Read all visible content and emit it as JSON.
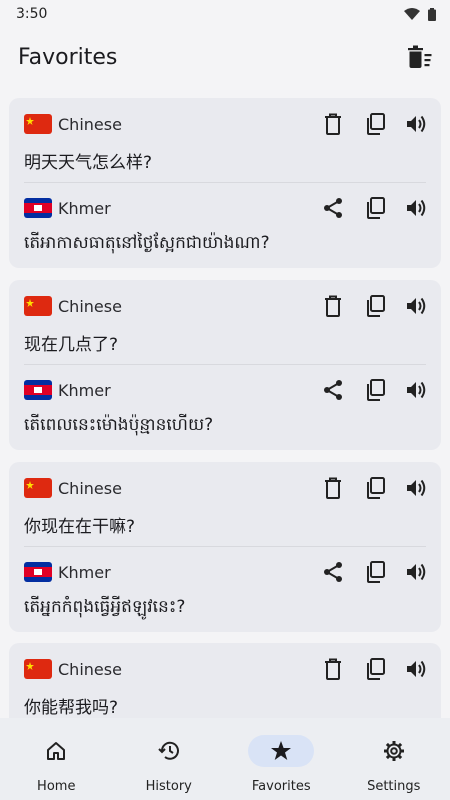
{
  "status_bar": {
    "time": "3:50"
  },
  "app_bar": {
    "title": "Favorites"
  },
  "cards": [
    {
      "source_lang": "Chinese",
      "source_text": "明天天气怎么样?",
      "target_lang": "Khmer",
      "target_text": "តើអាកាសធាតុនៅថ្ងៃស្អែកជាយ៉ាងណា?"
    },
    {
      "source_lang": "Chinese",
      "source_text": "现在几点了?",
      "target_lang": "Khmer",
      "target_text": "តើពេលនេះម៉ោងប៉ុន្មានហើយ?"
    },
    {
      "source_lang": "Chinese",
      "source_text": "你现在在干嘛?",
      "target_lang": "Khmer",
      "target_text": "តើអ្នកកំពុងធ្វើអ្វីឥឡូវនេះ?"
    },
    {
      "source_lang": "Chinese",
      "source_text": "你能帮我吗?"
    }
  ],
  "nav": {
    "home": "Home",
    "history": "History",
    "favorites": "Favorites",
    "settings": "Settings"
  },
  "icons": {
    "delete": "trash-icon",
    "copy": "copy-icon",
    "speak": "speaker-icon",
    "share": "share-icon",
    "clear_all": "clear-all-icon"
  },
  "colors": {
    "nav_active": "#d9e3f6",
    "card": "#e9eaef"
  }
}
